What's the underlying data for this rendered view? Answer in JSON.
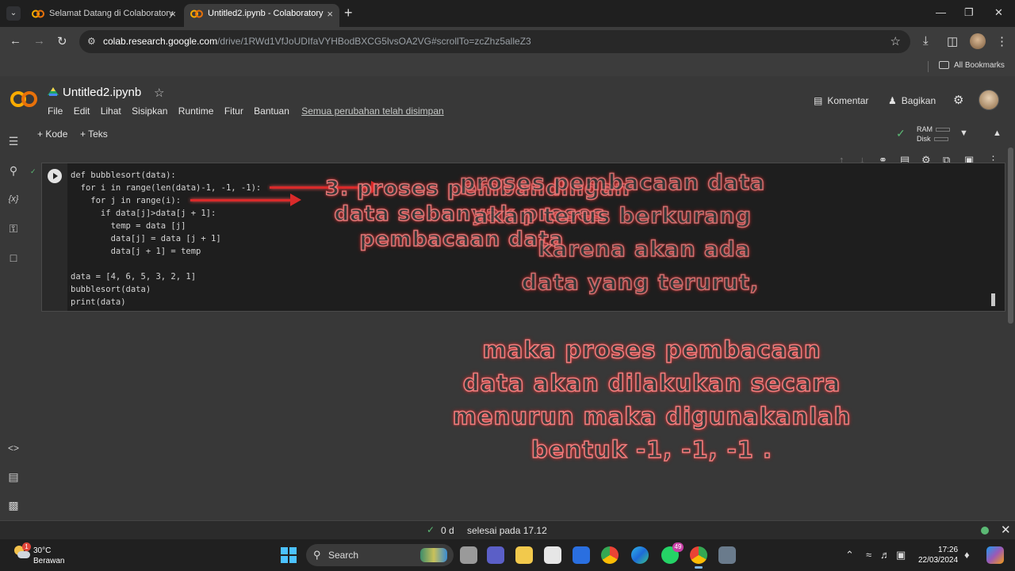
{
  "browser": {
    "tabs": [
      {
        "title": "Selamat Datang di Colaboratory",
        "active": false
      },
      {
        "title": "Untitled2.ipynb - Colaboratory",
        "active": true
      }
    ],
    "url_host": "colab.research.google.com",
    "url_path": "/drive/1RWd1VfJoUDIfaVYHBodBXCG5lvsOA2VG#scrollTo=zcZhz5alleZ3",
    "bookmarks_label": "All Bookmarks"
  },
  "colab": {
    "logo_text": "CO",
    "notebook_title": "Untitled2.ipynb",
    "menu": [
      "File",
      "Edit",
      "Lihat",
      "Sisipkan",
      "Runtime",
      "Fitur",
      "Bantuan"
    ],
    "save_status": "Semua perubahan telah disimpan",
    "comment_label": "Komentar",
    "share_label": "Bagikan",
    "add_code_label": "+ Kode",
    "add_text_label": "+ Teks",
    "ram_label": "RAM",
    "disk_label": "Disk"
  },
  "code_lines": [
    "def bubblesort(data):",
    "  for i in range(len(data)-1, -1, -1):",
    "    for j in range(i):",
    "      if data[j]>data[j + 1]:",
    "        temp = data [j]",
    "        data[j] = data [j + 1]",
    "        data[j + 1] = temp",
    "",
    "data = [4, 6, 5, 3, 2, 1]",
    "bubblesort(data)",
    "print(data)"
  ],
  "annotations": {
    "overlay_a": [
      "3. proses pembandingan",
      "data sebanyak proses",
      "pembacaan data"
    ],
    "overlay_b": [
      "proses pembacaan data",
      "akan terus berkurang",
      "karena akan ada",
      "data yang terurut,"
    ],
    "overlay_c": [
      "maka proses pembacaan",
      "data akan dilakukan secara",
      "menurun maka digunakanlah",
      "bentuk -1, -1, -1 ."
    ]
  },
  "status": {
    "duration": "0 d",
    "completed": "selesai pada 17.12"
  },
  "taskbar": {
    "weather_temp": "30°C",
    "weather_desc": "Berawan",
    "weather_badge": "1",
    "search_label": "Search",
    "whatsapp_badge": "49",
    "time": "17:26",
    "date": "22/03/2024"
  },
  "colors": {
    "accent_orange": "#f9ab00",
    "annotation_red": "#d92a2a",
    "success_green": "#5bb974"
  }
}
